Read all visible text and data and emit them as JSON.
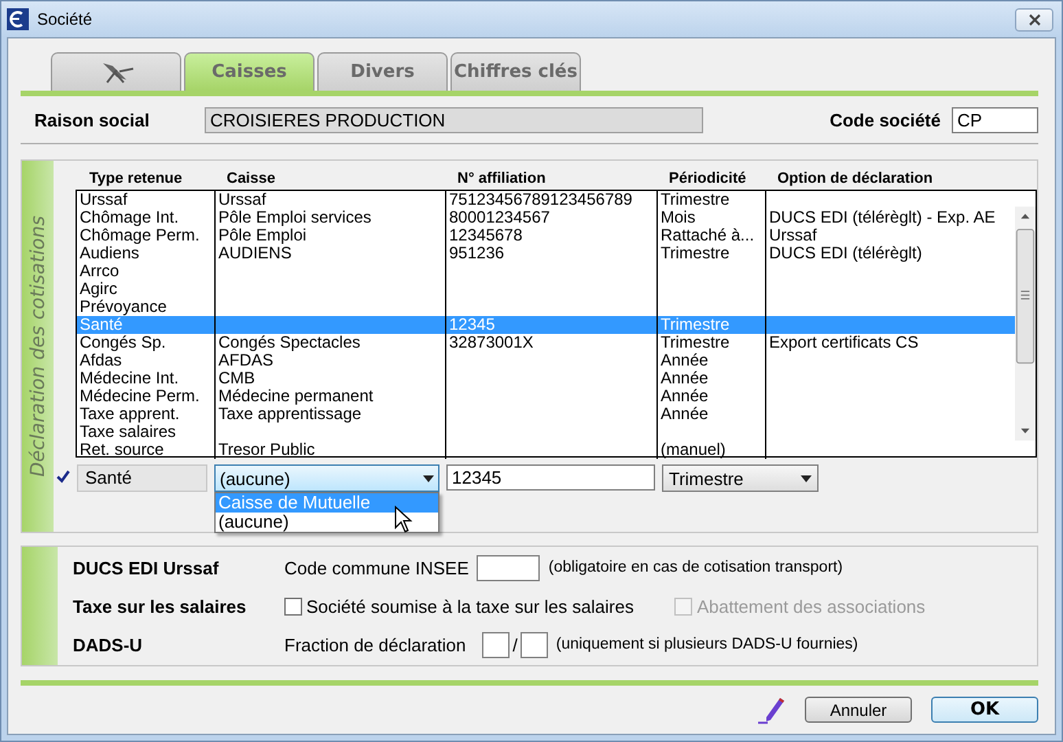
{
  "window": {
    "title": "Société"
  },
  "tabs": [
    {
      "kind": "icon",
      "selected": false
    },
    {
      "kind": "text",
      "label": "Caisses",
      "selected": true
    },
    {
      "kind": "text",
      "label": "Divers",
      "selected": false
    },
    {
      "kind": "text",
      "label": "Chiffres clés",
      "selected": false
    }
  ],
  "company": {
    "name_label": "Raison social",
    "name_value": "CROISIERES PRODUCTION",
    "code_label": "Code société",
    "code_value": "CP"
  },
  "cotisations": {
    "section_title": "Déclaration des cotisations",
    "columns": [
      "Type retenue",
      "Caisse",
      "N° affiliation",
      "Périodicité",
      "Option de déclaration"
    ],
    "rows": [
      {
        "cells": [
          "Urssaf",
          "Urssaf",
          "75123456789123456789",
          "Trimestre",
          ""
        ],
        "selected": false
      },
      {
        "cells": [
          "Chômage Int.",
          "Pôle Emploi services",
          "80001234567",
          "Mois",
          "DUCS EDI (télérèglt) - Exp. AE"
        ],
        "selected": false
      },
      {
        "cells": [
          "Chômage Perm.",
          "Pôle Emploi",
          "12345678",
          "Rattaché à...",
          "Urssaf"
        ],
        "selected": false
      },
      {
        "cells": [
          "Audiens",
          "AUDIENS",
          "951236",
          "Trimestre",
          "DUCS EDI (télérèglt)"
        ],
        "selected": false
      },
      {
        "cells": [
          "Arrco",
          "",
          "",
          "",
          ""
        ],
        "selected": false
      },
      {
        "cells": [
          "Agirc",
          "",
          "",
          "",
          ""
        ],
        "selected": false
      },
      {
        "cells": [
          "Prévoyance",
          "",
          "",
          "",
          ""
        ],
        "selected": false
      },
      {
        "cells": [
          "Santé",
          "",
          "12345",
          "Trimestre",
          ""
        ],
        "selected": true
      },
      {
        "cells": [
          "Congés Sp.",
          "Congés Spectacles",
          "32873001X",
          "Trimestre",
          "Export certificats CS"
        ],
        "selected": false
      },
      {
        "cells": [
          "Afdas",
          "AFDAS",
          "",
          "Année",
          ""
        ],
        "selected": false
      },
      {
        "cells": [
          "Médecine Int.",
          "CMB",
          "",
          "Année",
          ""
        ],
        "selected": false
      },
      {
        "cells": [
          "Médecine Perm.",
          "Médecine permanent",
          "",
          "Année",
          ""
        ],
        "selected": false
      },
      {
        "cells": [
          "Taxe apprent.",
          "Taxe apprentissage",
          "",
          "Année",
          ""
        ],
        "selected": false
      },
      {
        "cells": [
          "Taxe salaires",
          "",
          "",
          "",
          ""
        ],
        "selected": false
      },
      {
        "cells": [
          "Ret. source",
          "Tresor Public",
          "",
          "(manuel)",
          ""
        ],
        "selected": false
      }
    ],
    "editor": {
      "checked": true,
      "type_label": "Santé",
      "caisse_value": "(aucune)",
      "caisse_options": [
        {
          "label": "Caisse de Mutuelle",
          "selected": true
        },
        {
          "label": "(aucune)",
          "selected": false
        }
      ],
      "affiliation": "12345",
      "periodicite": "Trimestre"
    }
  },
  "settings": {
    "ducs": {
      "label": "DUCS EDI Urssaf",
      "field_label": "Code commune INSEE",
      "hint": "(obligatoire en cas de cotisation transport)"
    },
    "taxe": {
      "label": "Taxe sur les salaires",
      "options": [
        {
          "label": "Société soumise à la taxe sur les salaires",
          "checked": false,
          "disabled": false
        },
        {
          "label": "Abattement des associations",
          "checked": false,
          "disabled": true
        }
      ]
    },
    "dads": {
      "label": "DADS-U",
      "field_label": "Fraction de déclaration",
      "separator": "/",
      "hint": "(uniquement si plusieurs DADS-U fournies)"
    }
  },
  "buttons": [
    {
      "label": "Annuler",
      "default": false
    },
    {
      "label": "OK",
      "default": true
    }
  ]
}
